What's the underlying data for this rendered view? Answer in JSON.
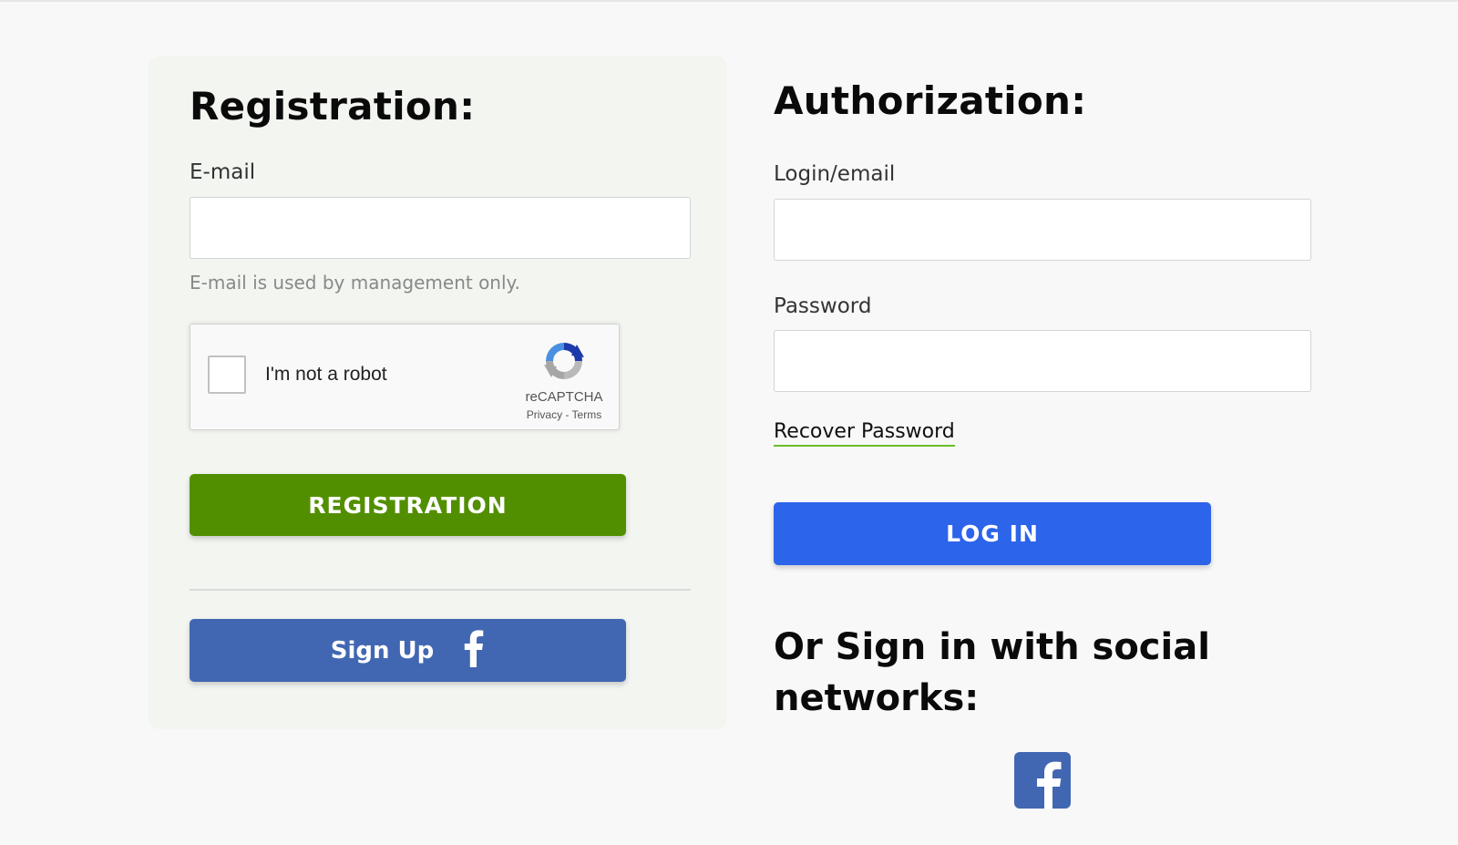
{
  "registration": {
    "title": "Registration:",
    "email_label": "E-mail",
    "email_value": "",
    "email_hint": "E-mail is used by management only.",
    "captcha": {
      "text": "I'm not a robot",
      "brand": "reCAPTCHA",
      "links": "Privacy - Terms",
      "checked": false
    },
    "register_button": "REGISTRATION",
    "facebook_button": "Sign Up"
  },
  "authorization": {
    "title": "Authorization:",
    "login_label": "Login/email",
    "login_value": "",
    "password_label": "Password",
    "password_value": "",
    "recover_link": "Recover Password",
    "login_button": "LOG IN",
    "social_title": "Or Sign in with social networks:"
  },
  "colors": {
    "register_green": "#528f00",
    "login_blue": "#2c64ea",
    "facebook_blue": "#4267b2",
    "link_underline": "#6bbf2a"
  },
  "icons": {
    "captcha": "recaptcha-logo-icon",
    "facebook": "facebook-icon",
    "facebook_square": "facebook-square-icon"
  }
}
